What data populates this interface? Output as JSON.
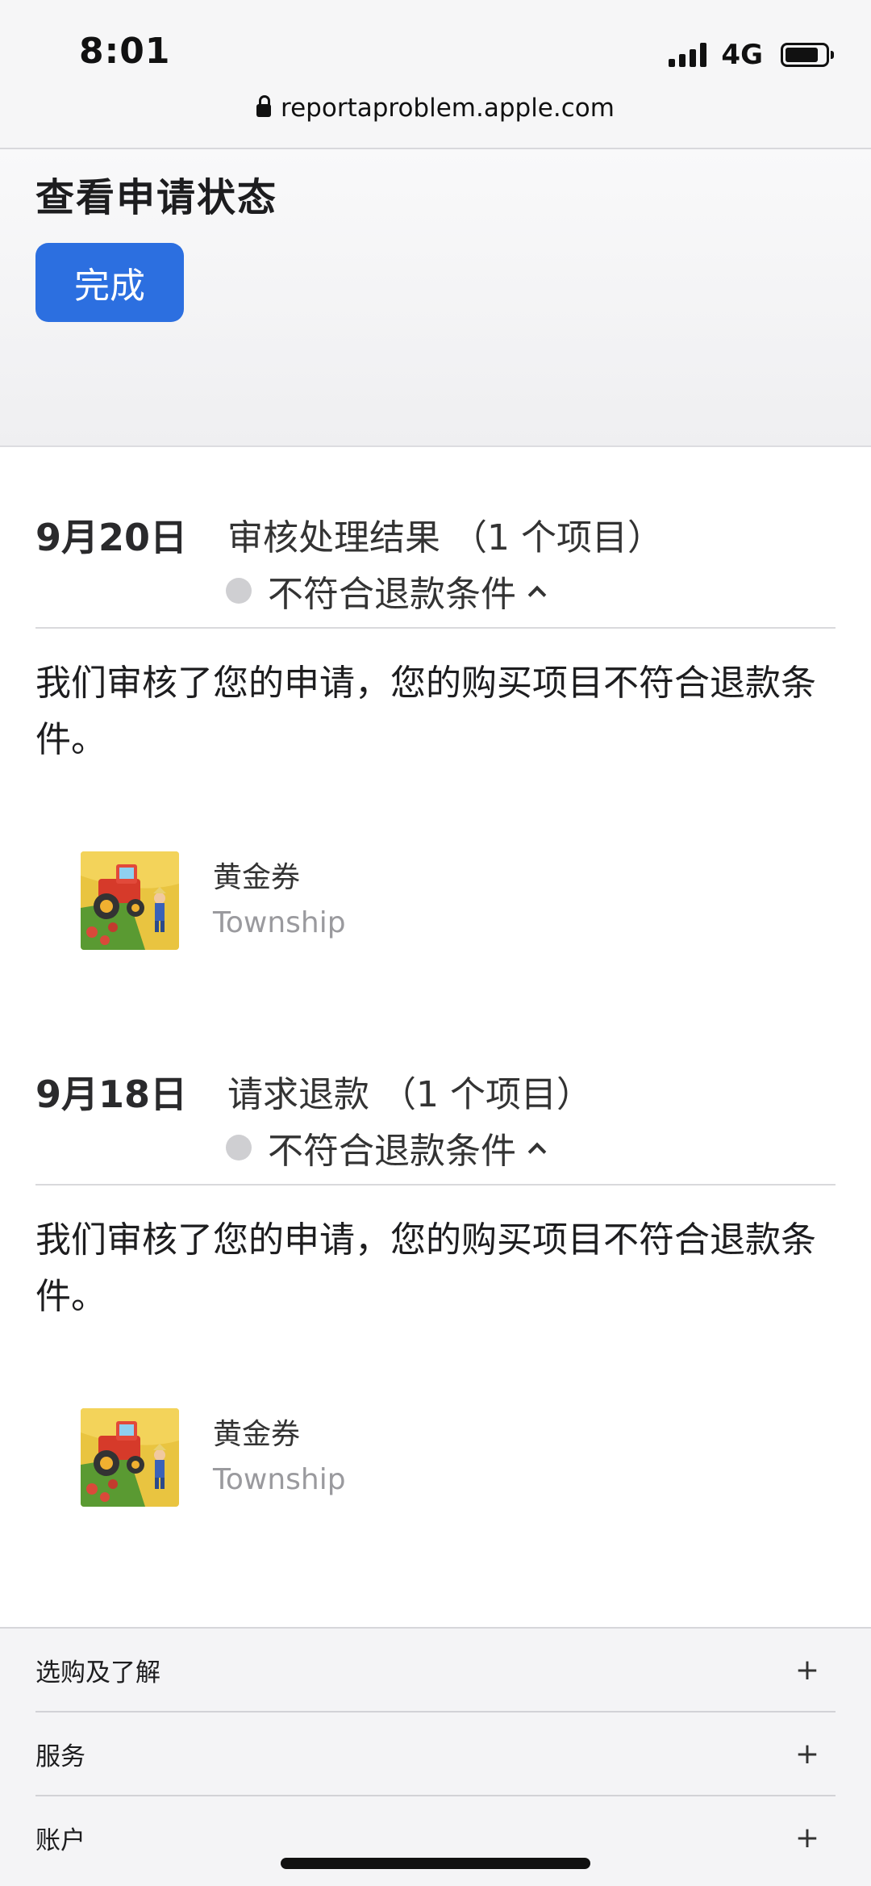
{
  "status_bar": {
    "time": "8:01",
    "network": "4G"
  },
  "url_bar": {
    "domain": "reportaproblem.apple.com"
  },
  "header": {
    "title": "查看申请状态",
    "done_label": "完成"
  },
  "requests": [
    {
      "date": "9月20日",
      "title": "审核处理结果 （1 个项目）",
      "status": "不符合退款条件",
      "message": "我们审核了您的申请，您的购买项目不符合退款条件。",
      "item_name": "黄金券",
      "item_app": "Township"
    },
    {
      "date": "9月18日",
      "title": "请求退款 （1 个项目）",
      "status": "不符合退款条件",
      "message": "我们审核了您的申请，您的购买项目不符合退款条件。",
      "item_name": "黄金券",
      "item_app": "Township"
    }
  ],
  "footer": {
    "items": [
      {
        "label": "选购及了解",
        "icon": "+"
      },
      {
        "label": "服务",
        "icon": "+"
      },
      {
        "label": "账户",
        "icon": "+"
      }
    ]
  },
  "colors": {
    "accent": "#2c6fe0",
    "status_dot": "#cfcfd2",
    "secondary_text": "#9a9a9e"
  },
  "icons": {
    "lock": "lock-icon",
    "chevron": "chevron-up-icon",
    "app": "township-app-icon"
  }
}
